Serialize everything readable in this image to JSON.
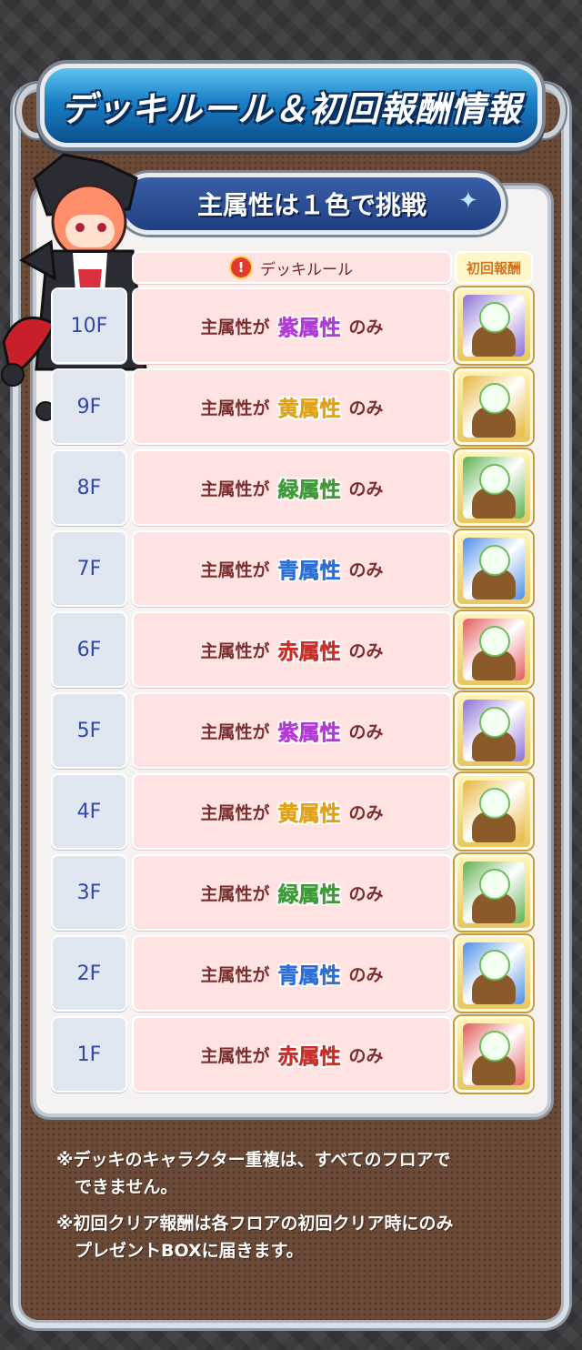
{
  "title": "デッキルール＆初回報酬情報",
  "subtitle": "主属性は１色で挑戦",
  "header": {
    "rule_label": "デッキルール",
    "reward_label": "初回報酬"
  },
  "rule_prefix": "主属性が",
  "rule_suffix": "のみ",
  "floors": [
    {
      "floor": "10F",
      "attribute": "紫属性",
      "color": "#b23bd6",
      "reward_bg": "#8b6fd6"
    },
    {
      "floor": "9F",
      "attribute": "黄属性",
      "color": "#e0a21a",
      "reward_bg": "#e7b53a"
    },
    {
      "floor": "8F",
      "attribute": "緑属性",
      "color": "#3f9a3a",
      "reward_bg": "#5fb04f"
    },
    {
      "floor": "7F",
      "attribute": "青属性",
      "color": "#2c6fd6",
      "reward_bg": "#4d8ee6"
    },
    {
      "floor": "6F",
      "attribute": "赤属性",
      "color": "#c8302b",
      "reward_bg": "#e35a5a"
    },
    {
      "floor": "5F",
      "attribute": "紫属性",
      "color": "#b23bd6",
      "reward_bg": "#8b6fd6"
    },
    {
      "floor": "4F",
      "attribute": "黄属性",
      "color": "#e0a21a",
      "reward_bg": "#e7b53a"
    },
    {
      "floor": "3F",
      "attribute": "緑属性",
      "color": "#3f9a3a",
      "reward_bg": "#5fb04f"
    },
    {
      "floor": "2F",
      "attribute": "青属性",
      "color": "#2c6fd6",
      "reward_bg": "#4d8ee6"
    },
    {
      "floor": "1F",
      "attribute": "赤属性",
      "color": "#c8302b",
      "reward_bg": "#e35a5a"
    }
  ],
  "notes": {
    "line1": "※デッキのキャラクター重複は、すべてのフロアで",
    "line1b": "できません。",
    "line2": "※初回クリア報酬は各フロアの初回クリア時にのみ",
    "line2b": "プレゼントBOXに届きます。"
  }
}
